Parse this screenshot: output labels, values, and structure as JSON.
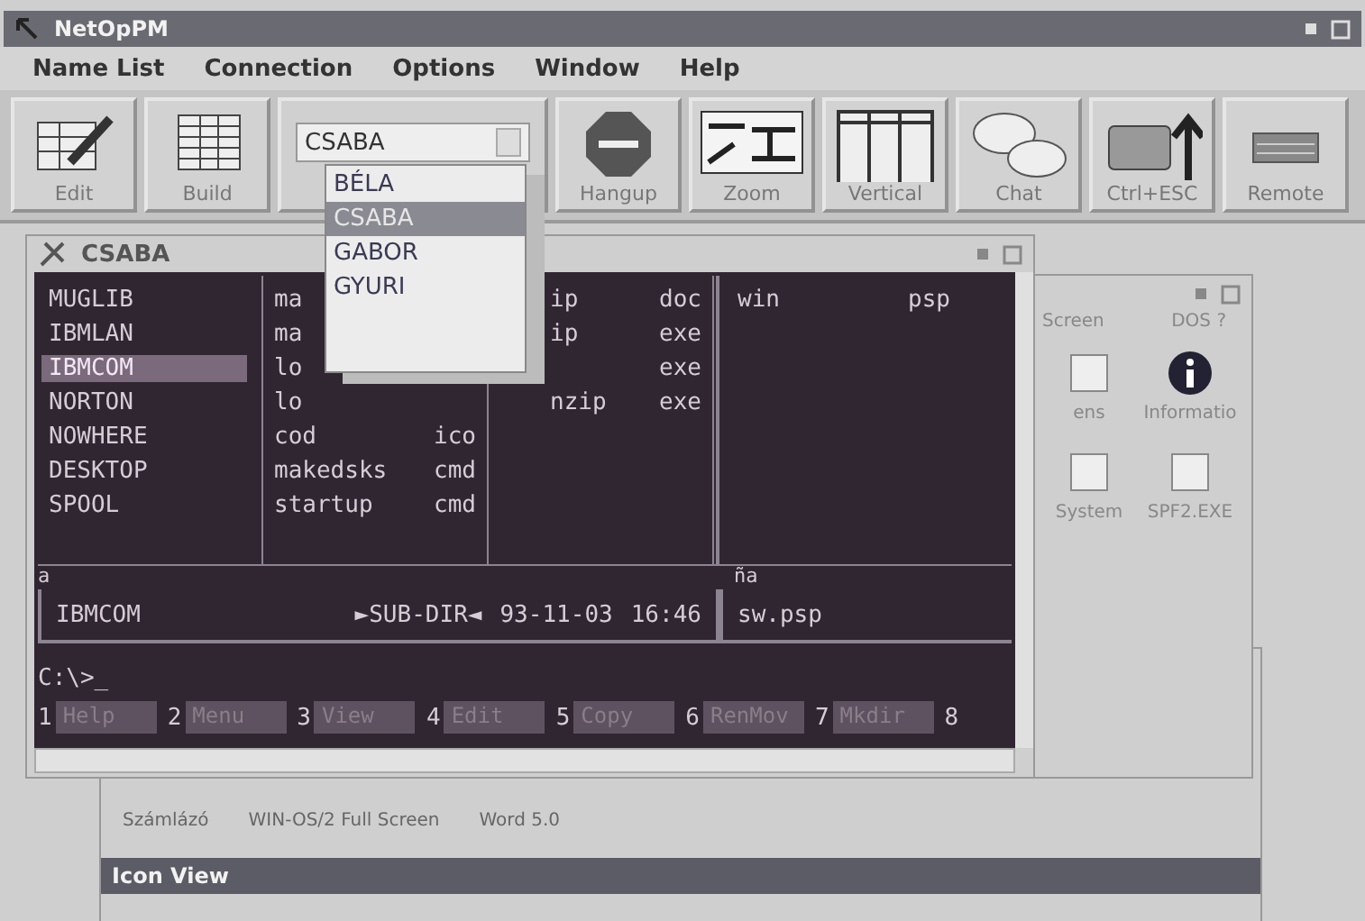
{
  "window": {
    "title": "NetOpPM"
  },
  "menu": [
    {
      "label": "Name List"
    },
    {
      "label": "Connection"
    },
    {
      "label": "Options"
    },
    {
      "label": "Window"
    },
    {
      "label": "Help"
    }
  ],
  "toolbar": [
    {
      "kind": "button",
      "label": "Edit"
    },
    {
      "kind": "button",
      "label": "Build"
    },
    {
      "kind": "combo",
      "value": "CSABA",
      "options": [
        {
          "label": "BÉLA",
          "selected": false
        },
        {
          "label": "CSABA",
          "selected": true
        },
        {
          "label": "GABOR",
          "selected": false
        },
        {
          "label": "GYURI",
          "selected": false
        }
      ]
    },
    {
      "kind": "button",
      "label": "Hangup"
    },
    {
      "kind": "button",
      "label": "Zoom"
    },
    {
      "kind": "button",
      "label": "Vertical"
    },
    {
      "kind": "button",
      "label": "Chat"
    },
    {
      "kind": "button",
      "label": "Ctrl+ESC"
    },
    {
      "kind": "button",
      "label": "Remote"
    }
  ],
  "session_window": {
    "title": "CSABA",
    "left_panel": {
      "drive": "a",
      "rows": [
        {
          "name": "MUGLIB",
          "selected": false,
          "col2": "ma",
          "col3": "ip",
          "col3_ext": "doc"
        },
        {
          "name": "IBMLAN",
          "selected": false,
          "col2": "ma",
          "col3": "ip",
          "col3_ext": "exe"
        },
        {
          "name": "IBMCOM",
          "selected": true,
          "col2": "lo",
          "col3_ext": "exe"
        },
        {
          "name": "NORTON",
          "selected": false,
          "col2": "lo",
          "col3": "nzip",
          "col3_ext": "exe"
        },
        {
          "name": "NOWHERE",
          "selected": false,
          "col2": "cod",
          "col2_ext": "ico"
        },
        {
          "name": "DESKTOP",
          "selected": false,
          "col2": "makedsks",
          "col2_ext": "cmd"
        },
        {
          "name": "SPOOL",
          "selected": false,
          "col2": "startup",
          "col2_ext": "cmd"
        }
      ]
    },
    "right_panel": {
      "drive": "ña",
      "rows": [
        {
          "name": "win",
          "ext": "psp"
        }
      ]
    },
    "info": {
      "name": "IBMCOM",
      "type": "►SUB-DIR◄",
      "date": "93-11-03",
      "time": "16:46",
      "right": "sw.psp"
    },
    "prompt": "C:\\>_",
    "function_keys": [
      {
        "key": "1",
        "label": "Help"
      },
      {
        "key": "2",
        "label": "Menu"
      },
      {
        "key": "3",
        "label": "View"
      },
      {
        "key": "4",
        "label": "Edit"
      },
      {
        "key": "5",
        "label": "Copy"
      },
      {
        "key": "6",
        "label": "RenMov"
      },
      {
        "key": "7",
        "label": "Mkdir"
      },
      {
        "key": "8"
      }
    ]
  },
  "background_window": {
    "header": [
      "Screen",
      "DOS ?"
    ],
    "icons": [
      {
        "label": "ens"
      },
      {
        "label": "Informatio"
      },
      {
        "label": "System"
      },
      {
        "label": "SPF2.EXE"
      }
    ]
  },
  "programs_window": {
    "items": [
      "Számlázó",
      "WIN-OS/2 Full Screen",
      "Word 5.0"
    ]
  },
  "icon_view_window": {
    "title": "Icon View"
  }
}
